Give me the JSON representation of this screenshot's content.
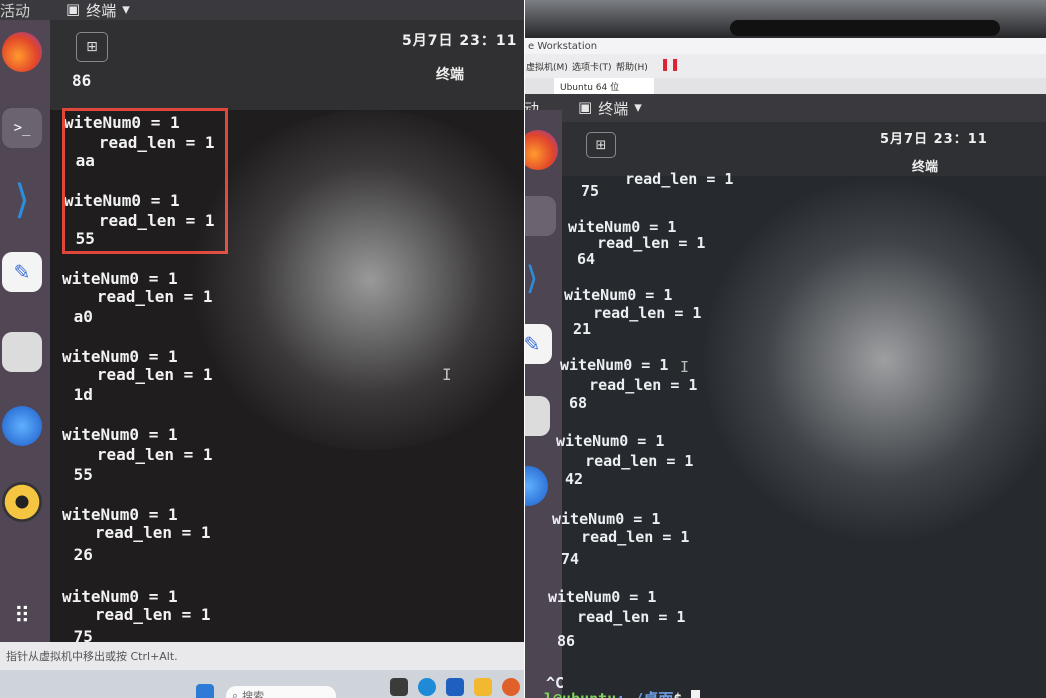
{
  "left": {
    "topbar": {
      "activities": "活动",
      "terminal_menu": "终端"
    },
    "header": {
      "clock": "5月7日 23：11",
      "title": "终端"
    },
    "terminal_lines": [
      "86",
      "witeNum0 = 1",
      "   read_len = 1",
      " aa",
      "witeNum0 = 1",
      "   read_len = 1",
      " 55",
      "witeNum0 = 1",
      "   read_len = 1",
      " a0",
      "witeNum0 = 1",
      "   read_len = 1",
      " 1d",
      "witeNum0 = 1",
      "   read_len = 1",
      " 55",
      "witeNum0 = 1",
      "   read_len = 1",
      " 26",
      "witeNum0 = 1",
      "   read_len = 1",
      " 75"
    ],
    "status_text": "要将输入定向到该虚拟机，请在虚拟机内部单击或按 Ctrl+G。 后将鼠标指针从虚拟机中移出或按 Ctrl+Alt。",
    "status_visible": "指针从虚拟机中移出或按 Ctrl+Alt.",
    "taskbar": {
      "search_placeholder": "搜索"
    }
  },
  "right": {
    "vm_window": {
      "title": "e Workstation",
      "menu_items": [
        "虚拟机(M)",
        "选项卡(T)",
        "帮助(H)"
      ],
      "tab_label": "Ubuntu 64 位"
    },
    "topbar": {
      "activities": "动",
      "terminal_menu": "终端"
    },
    "header": {
      "clock": "5月7日 23：11",
      "title": "终端"
    },
    "terminal_lines": [
      "   read_len = 1",
      " 75",
      "witeNum0 = 1",
      "   read_len = 1",
      " 64",
      "witeNum0 = 1",
      "   read_len = 1",
      " 21",
      "witeNum0 = 1",
      "   read_len = 1",
      " 68",
      "witeNum0 = 1",
      "   read_len = 1",
      " 42",
      "witeNum0 = 1",
      "   read_len = 1",
      " 74",
      "witeNum0 = 1",
      "   read_len = 1",
      " 86",
      "^C"
    ],
    "prompt": {
      "user": "l@ubuntu",
      "path": ":~/桌面",
      "symbol": "$"
    }
  }
}
